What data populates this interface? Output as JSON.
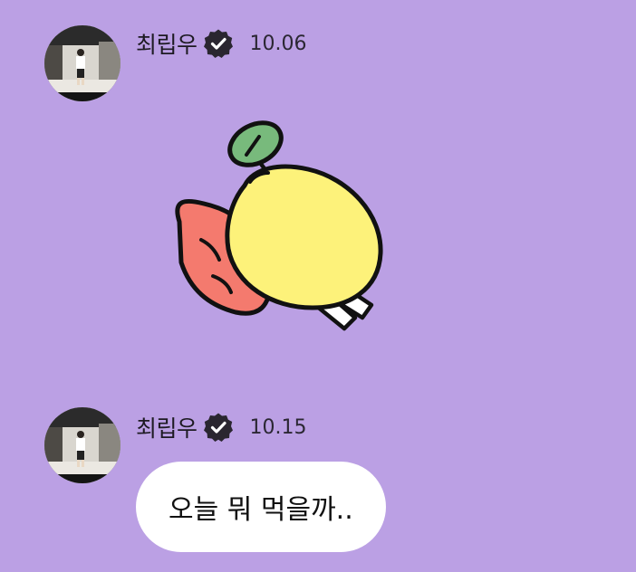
{
  "colors": {
    "background": "#bba0e4",
    "bubble": "#ffffff",
    "verified_badge": "#2a2630"
  },
  "messages": [
    {
      "sender": "최립우",
      "time": "10.06",
      "verified_icon": "verified-badge-icon",
      "content_type": "sticker",
      "sticker_icon": "sleeping-lemon-sticker-icon"
    },
    {
      "sender": "최립우",
      "time": "10.15",
      "verified_icon": "verified-badge-icon",
      "content_type": "text",
      "text": "오늘 뭐 먹을까.."
    }
  ]
}
